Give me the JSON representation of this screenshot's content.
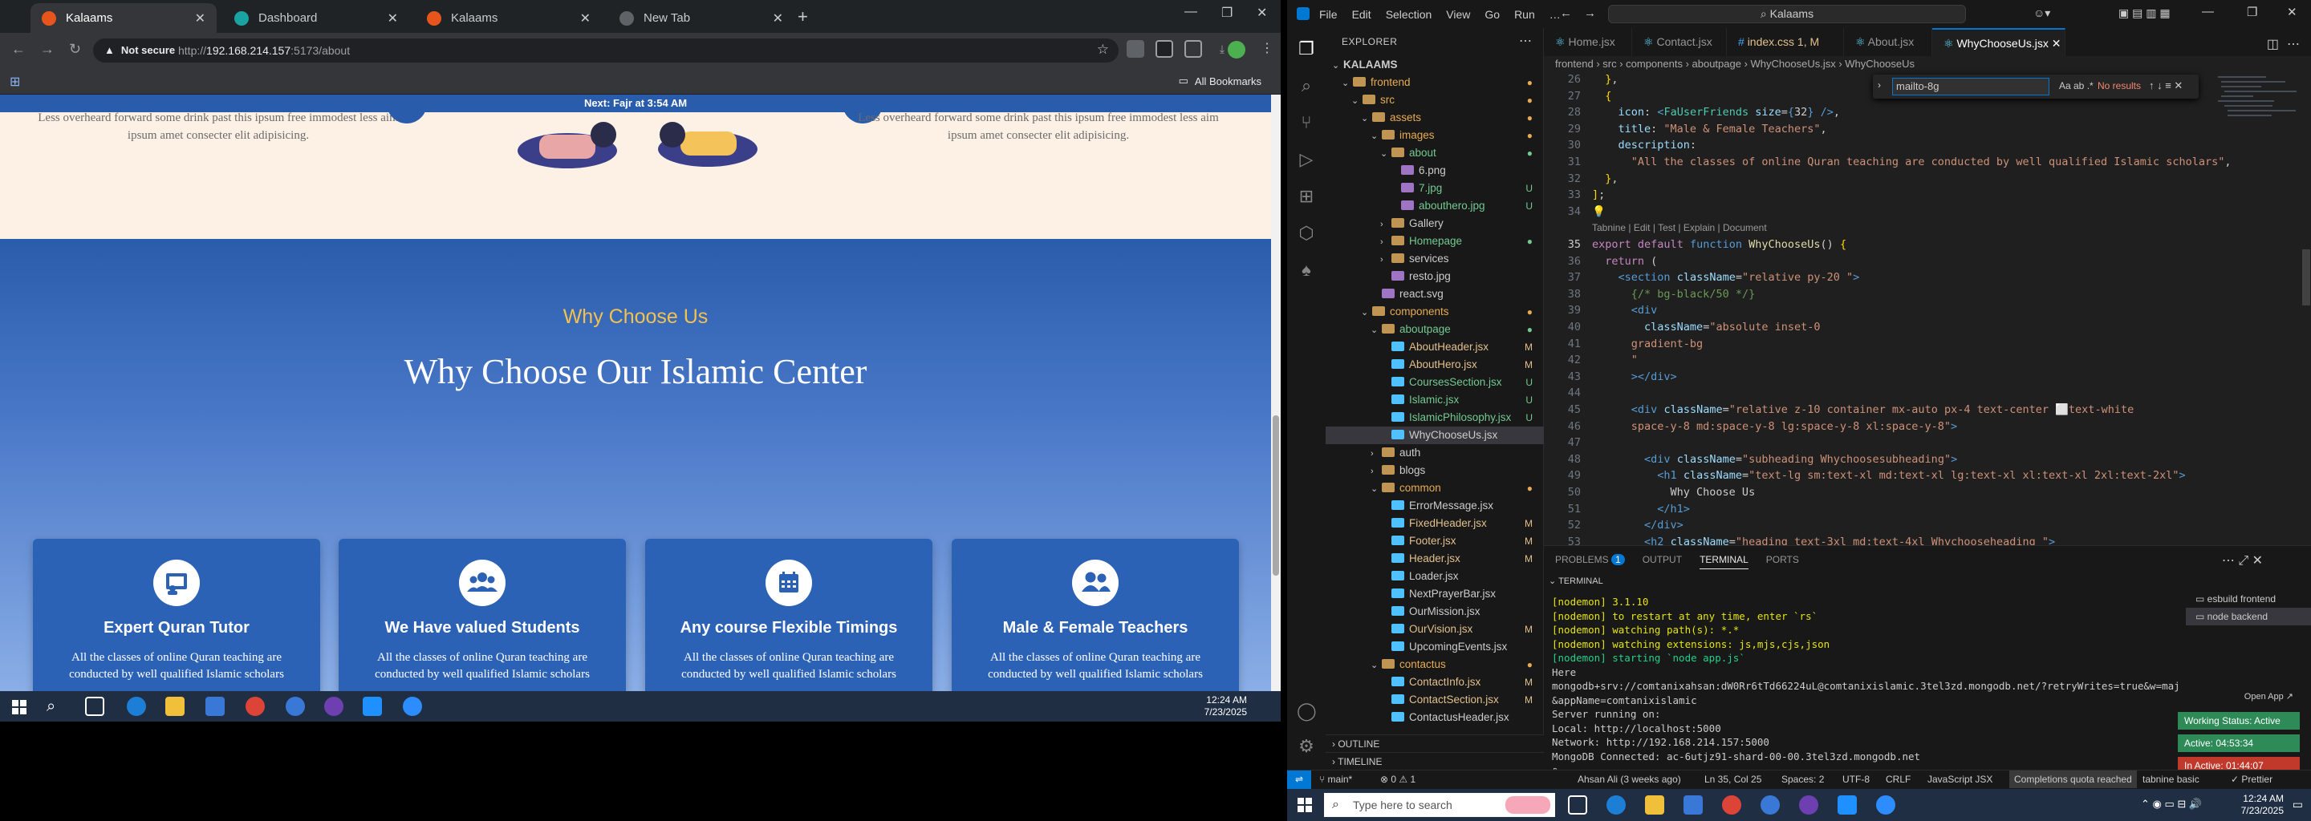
{
  "browser": {
    "tabs": [
      {
        "title": "Kalaams",
        "active": true,
        "favicon_color": "#e8551c"
      },
      {
        "title": "Dashboard",
        "active": false,
        "favicon_color": "#1aa3a3"
      },
      {
        "title": "Kalaams",
        "active": false,
        "favicon_color": "#e8551c"
      },
      {
        "title": "New Tab",
        "active": false,
        "favicon_color": "#5f6368"
      }
    ],
    "new_tab": "+",
    "not_secure": "Not secure",
    "url_prefix": "http://",
    "url_host": "192.168.214.157",
    "url_rest": ":5173/about",
    "all_bookmarks": "All Bookmarks"
  },
  "page": {
    "prayer_banner": "Next: Fajr at 3:54 AM",
    "old_text_left": "Less overheard forward some drink past this ipsum free immodest less aim ipsum amet consecter elit adipisicing.",
    "old_text_right": "Less overheard forward some drink past this ipsum free immodest less aim ipsum amet consecter elit adipisicing.",
    "subheading": "Why Choose Us",
    "heading": "Why Choose Our Islamic Center",
    "cards": [
      {
        "icon": "teacher-board-icon",
        "title": "Expert Quran Tutor",
        "description": "All the classes of online Quran teaching are conducted by well qualified Islamic scholars",
        "arrow": "→"
      },
      {
        "icon": "users-icon",
        "title": "We Have valued Students",
        "description": "All the classes of online Quran teaching are conducted by well qualified Islamic scholars",
        "arrow": "→"
      },
      {
        "icon": "calendar-icon",
        "title": "Any course Flexible Timings",
        "description": "All the classes of online Quran teaching are conducted by well qualified Islamic scholars",
        "arrow": "→"
      },
      {
        "icon": "user-friends-icon",
        "title": "Male & Female Teachers",
        "description": "All the classes of online Quran teaching are conducted by well qualified Islamic scholars",
        "arrow": "→"
      }
    ],
    "colors": {
      "primary_blue": "#2a5cac",
      "accent_yellow": "#f2c200",
      "cream": "#fdf1e6"
    }
  },
  "taskbar_left": {
    "time": "12:24 AM",
    "date": "7/23/2025"
  },
  "taskbar_right": {
    "search_placeholder": "Type here to search",
    "time": "12:24 AM",
    "date": "7/23/2025"
  },
  "vscode": {
    "menu": [
      "File",
      "Edit",
      "Selection",
      "View",
      "Go",
      "Run",
      "…"
    ],
    "command_center": "Kalaams",
    "explorer_title": "EXPLORER",
    "tree": [
      {
        "label": "KALAAMS",
        "depth": 0,
        "type": "root",
        "chev": "⌄",
        "badge": ""
      },
      {
        "label": "frontend",
        "depth": 1,
        "type": "folder",
        "chev": "⌄",
        "badge": "●",
        "color": "#e8ab53"
      },
      {
        "label": "src",
        "depth": 2,
        "type": "folder",
        "chev": "⌄",
        "badge": "●",
        "color": "#e8ab53"
      },
      {
        "label": "assets",
        "depth": 3,
        "type": "folder",
        "chev": "⌄",
        "badge": "●",
        "color": "#e8ab53"
      },
      {
        "label": "images",
        "depth": 4,
        "type": "folder",
        "chev": "⌄",
        "badge": "●",
        "color": "#e8ab53"
      },
      {
        "label": "about",
        "depth": 5,
        "type": "folder",
        "chev": "⌄",
        "badge": "●",
        "color": "#73c991"
      },
      {
        "label": "6.png",
        "depth": 6,
        "type": "file",
        "chev": "",
        "badge": "",
        "color": "#ccc"
      },
      {
        "label": "7.jpg",
        "depth": 6,
        "type": "file",
        "chev": "",
        "badge": "U",
        "color": "#73c991"
      },
      {
        "label": "abouthero.jpg",
        "depth": 6,
        "type": "file",
        "chev": "",
        "badge": "U",
        "color": "#73c991"
      },
      {
        "label": "Gallery",
        "depth": 5,
        "type": "folder",
        "chev": "›",
        "badge": "",
        "color": "#ccc"
      },
      {
        "label": "Homepage",
        "depth": 5,
        "type": "folder",
        "chev": "›",
        "badge": "●",
        "color": "#73c991"
      },
      {
        "label": "services",
        "depth": 5,
        "type": "folder",
        "chev": "›",
        "badge": "",
        "color": "#ccc"
      },
      {
        "label": "resto.jpg",
        "depth": 5,
        "type": "file",
        "chev": "",
        "badge": "",
        "color": "#ccc"
      },
      {
        "label": "react.svg",
        "depth": 4,
        "type": "file",
        "chev": "",
        "badge": "",
        "color": "#ccc"
      },
      {
        "label": "components",
        "depth": 3,
        "type": "folder",
        "chev": "⌄",
        "badge": "●",
        "color": "#e8ab53"
      },
      {
        "label": "aboutpage",
        "depth": 4,
        "type": "folder",
        "chev": "⌄",
        "badge": "●",
        "color": "#73c991"
      },
      {
        "label": "AboutHeader.jsx",
        "depth": 5,
        "type": "file",
        "chev": "",
        "badge": "M",
        "color": "#e2c08d"
      },
      {
        "label": "AboutHero.jsx",
        "depth": 5,
        "type": "file",
        "chev": "",
        "badge": "M",
        "color": "#e2c08d"
      },
      {
        "label": "CoursesSection.jsx",
        "depth": 5,
        "type": "file",
        "chev": "",
        "badge": "U",
        "color": "#73c991"
      },
      {
        "label": "Islamic.jsx",
        "depth": 5,
        "type": "file",
        "chev": "",
        "badge": "U",
        "color": "#73c991"
      },
      {
        "label": "IslamicPhilosophy.jsx",
        "depth": 5,
        "type": "file",
        "chev": "",
        "badge": "U",
        "color": "#73c991"
      },
      {
        "label": "WhyChooseUs.jsx",
        "depth": 5,
        "type": "file",
        "chev": "",
        "badge": "",
        "color": "#ccc",
        "selected": true
      },
      {
        "label": "auth",
        "depth": 4,
        "type": "folder",
        "chev": "›",
        "badge": "",
        "color": "#ccc"
      },
      {
        "label": "blogs",
        "depth": 4,
        "type": "folder",
        "chev": "›",
        "badge": "",
        "color": "#ccc"
      },
      {
        "label": "common",
        "depth": 4,
        "type": "folder",
        "chev": "⌄",
        "badge": "●",
        "color": "#e8ab53"
      },
      {
        "label": "ErrorMessage.jsx",
        "depth": 5,
        "type": "file",
        "chev": "",
        "badge": "",
        "color": "#ccc"
      },
      {
        "label": "FixedHeader.jsx",
        "depth": 5,
        "type": "file",
        "chev": "",
        "badge": "M",
        "color": "#e2c08d"
      },
      {
        "label": "Footer.jsx",
        "depth": 5,
        "type": "file",
        "chev": "",
        "badge": "M",
        "color": "#e2c08d"
      },
      {
        "label": "Header.jsx",
        "depth": 5,
        "type": "file",
        "chev": "",
        "badge": "M",
        "color": "#e2c08d"
      },
      {
        "label": "Loader.jsx",
        "depth": 5,
        "type": "file",
        "chev": "",
        "badge": "",
        "color": "#ccc"
      },
      {
        "label": "NextPrayerBar.jsx",
        "depth": 5,
        "type": "file",
        "chev": "",
        "badge": "",
        "color": "#ccc"
      },
      {
        "label": "OurMission.jsx",
        "depth": 5,
        "type": "file",
        "chev": "",
        "badge": "",
        "color": "#ccc"
      },
      {
        "label": "OurVision.jsx",
        "depth": 5,
        "type": "file",
        "chev": "",
        "badge": "M",
        "color": "#e2c08d"
      },
      {
        "label": "UpcomingEvents.jsx",
        "depth": 5,
        "type": "file",
        "chev": "",
        "badge": "",
        "color": "#ccc"
      },
      {
        "label": "contactus",
        "depth": 4,
        "type": "folder",
        "chev": "⌄",
        "badge": "●",
        "color": "#e8ab53"
      },
      {
        "label": "ContactInfo.jsx",
        "depth": 5,
        "type": "file",
        "chev": "",
        "badge": "M",
        "color": "#e2c08d"
      },
      {
        "label": "ContactSection.jsx",
        "depth": 5,
        "type": "file",
        "chev": "",
        "badge": "M",
        "color": "#e2c08d"
      },
      {
        "label": "ContactusHeader.jsx",
        "depth": 5,
        "type": "file",
        "chev": "",
        "badge": "",
        "color": "#ccc"
      }
    ],
    "outline": "OUTLINE",
    "timeline": "TIMELINE",
    "editor_tabs": [
      {
        "label": "Home.jsx",
        "active": false
      },
      {
        "label": "Contact.jsx",
        "active": false
      },
      {
        "label": "index.css 1, M",
        "active": false
      },
      {
        "label": "About.jsx",
        "active": false
      },
      {
        "label": "WhyChooseUs.jsx",
        "active": true
      }
    ],
    "breadcrumb": "frontend › src › components › aboutpage › WhyChooseUs.jsx › WhyChooseUs",
    "find_value": "mailto-8g",
    "find_result": "No results",
    "code_lines": [
      {
        "n": "26",
        "html": "  <span class='p'>}</span>,"
      },
      {
        "n": "27",
        "html": "  <span class='p'>{</span>"
      },
      {
        "n": "28",
        "html": "    <span class='a'>icon</span>: <span class='k'>&lt;</span><span class='t'>FaUserFriends</span> <span class='a'>size</span>=<span class='k'>{</span>32<span class='k'>}</span> <span class='k'>/&gt;</span>,"
      },
      {
        "n": "29",
        "html": "    <span class='a'>title</span>: <span class='s'>\"Male &amp; Female Teachers\"</span>,"
      },
      {
        "n": "30",
        "html": "    <span class='a'>description</span>:"
      },
      {
        "n": "31",
        "html": "      <span class='s'>\"All the classes of online Quran teaching are conducted by well qualified Islamic scholars\"</span>,"
      },
      {
        "n": "32",
        "html": "  <span class='p'>}</span>,"
      },
      {
        "n": "33",
        "html": "<span class='p'>]</span>;"
      },
      {
        "n": "34",
        "html": "<span class='p'>💡</span>"
      },
      {
        "n": "",
        "html": "<span class='c' style='color:#999;font-family:Liberation Sans,sans-serif;font-size:12px'>Tabnine | Edit | Test | Explain | Document</span>"
      },
      {
        "n": "35",
        "html": "<span class='pk'>export</span> <span class='pk'>default</span> <span class='k'>function</span> <span class='f'>WhyChooseUs</span>() <span class='p'>{</span>"
      },
      {
        "n": "36",
        "html": "  <span class='pk'>return</span> ("
      },
      {
        "n": "37",
        "html": "    <span class='k'>&lt;</span><span class='k'>section</span> <span class='a'>className</span>=<span class='s'>\"relative py-20 \"</span><span class='k'>&gt;</span>"
      },
      {
        "n": "38",
        "html": "      <span class='c'>{/* bg-black/50 */}</span>"
      },
      {
        "n": "39",
        "html": "      <span class='k'>&lt;div</span>"
      },
      {
        "n": "40",
        "html": "        <span class='a'>className</span>=<span class='s'>\"absolute inset-0</span>"
      },
      {
        "n": "41",
        "html": "      <span class='s'>gradient-bg</span>"
      },
      {
        "n": "42",
        "html": "      <span class='s'>\"</span>"
      },
      {
        "n": "43",
        "html": "      <span class='k'>&gt;&lt;/div&gt;</span>"
      },
      {
        "n": "44",
        "html": ""
      },
      {
        "n": "45",
        "html": "      <span class='k'>&lt;div</span> <span class='a'>className</span>=<span class='s'>\"relative z-10 container mx-auto px-4 text-center ⬜text-white</span>"
      },
      {
        "n": "46",
        "html": "      <span class='s'>space-y-8 md:space-y-8 lg:space-y-8 xl:space-y-8\"</span><span class='k'>&gt;</span>"
      },
      {
        "n": "47",
        "html": ""
      },
      {
        "n": "48",
        "html": "        <span class='k'>&lt;div</span> <span class='a'>className</span>=<span class='s'>\"subheading Whychoosesubheading\"</span><span class='k'>&gt;</span>"
      },
      {
        "n": "49",
        "html": "          <span class='k'>&lt;h1</span> <span class='a'>className</span>=<span class='s'>\"text-lg sm:text-xl md:text-xl lg:text-xl xl:text-xl 2xl:text-2xl\"</span><span class='k'>&gt;</span>"
      },
      {
        "n": "50",
        "html": "            Why Choose Us"
      },
      {
        "n": "51",
        "html": "          <span class='k'>&lt;/h1&gt;</span>"
      },
      {
        "n": "52",
        "html": "        <span class='k'>&lt;/div&gt;</span>"
      },
      {
        "n": "53",
        "html": "        <span class='k'>&lt;h2</span> <span class='a'>className</span>=<span class='s'>\"heading text-3xl md:text-4xl Whychooseheading \"</span><span class='k'>&gt;</span>"
      },
      {
        "n": "54",
        "html": "          Why Choose Our Islamic Center"
      }
    ],
    "panel_tabs": [
      "PROBLEMS",
      "OUTPUT",
      "TERMINAL",
      "PORTS"
    ],
    "problems_count": "1",
    "terminal_header": "TERMINAL",
    "terminal_lines": [
      {
        "cls": "y",
        "text": "[nodemon] 3.1.10"
      },
      {
        "cls": "y",
        "text": "[nodemon] to restart at any time, enter `rs`"
      },
      {
        "cls": "y",
        "text": "[nodemon] watching path(s): *.*"
      },
      {
        "cls": "y",
        "text": "[nodemon] watching extensions: js,mjs,cjs,json"
      },
      {
        "cls": "g",
        "text": "[nodemon] starting `node app.js`"
      },
      {
        "cls": "",
        "text": "Here"
      },
      {
        "cls": "",
        "text": "mongodb+srv://comtanixahsan:dW0Rr6tTd66224uL@comtanixislamic.3tel3zd.mongodb.net/?retryWrites=true&w=majority"
      },
      {
        "cls": "",
        "text": "&appName=comtanixislamic"
      },
      {
        "cls": "",
        "text": "Server running on:"
      },
      {
        "cls": "",
        "text": "  Local: http://localhost:5000"
      },
      {
        "cls": "",
        "text": "  Network: http://192.168.214.157:5000"
      },
      {
        "cls": "",
        "text": "MongoDB Connected: ac-6utjz91-shard-00-00.3tel3zd.mongodb.net"
      },
      {
        "cls": "",
        "text": "▯"
      }
    ],
    "terminal_list": [
      "esbuild frontend",
      "node backend"
    ],
    "open_app": "Open App ↗",
    "overlays": [
      {
        "text": "Working Status: Active",
        "color": "#2e8b57"
      },
      {
        "text": "Active: 04:53:34",
        "color": "#2e8b57"
      },
      {
        "text": "In Active: 01:44:07",
        "color": "#c0392b"
      }
    ],
    "status": {
      "branch": "main*",
      "errors": "⊗ 0 ⚠ 1",
      "author": "Ahsan Ali (3 weeks ago)",
      "position": "Ln 35, Col 25",
      "spaces": "Spaces: 2",
      "encoding": "UTF-8",
      "eol": "CRLF",
      "language": "JavaScript JSX",
      "quota": "Completions quota reached",
      "tabnine": "tabnine basic",
      "prettier": "✓ Prettier"
    }
  }
}
